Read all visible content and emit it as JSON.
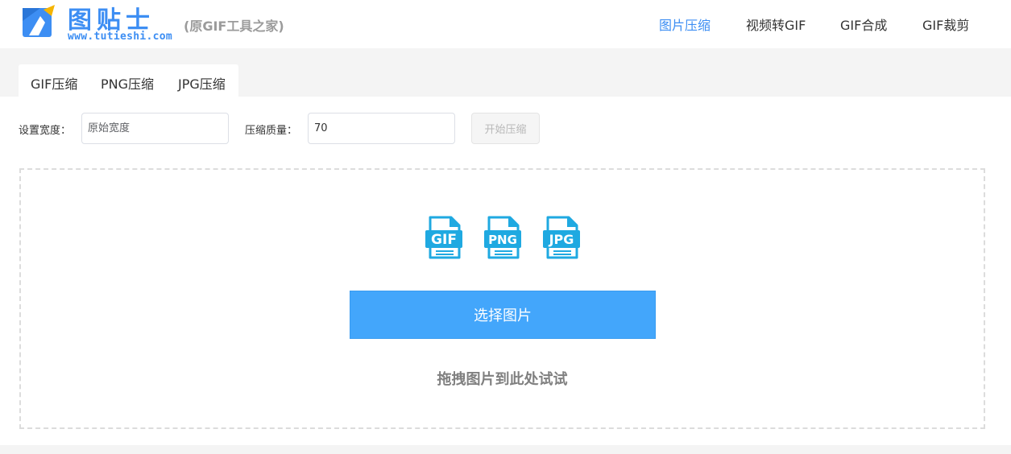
{
  "header": {
    "logo_title": "图贴士",
    "logo_url": "www.tutieshi.com",
    "logo_subtitle": "(原GIF工具之家)",
    "nav": [
      {
        "label": "图片压缩",
        "active": true
      },
      {
        "label": "视频转GIF",
        "active": false
      },
      {
        "label": "GIF合成",
        "active": false
      },
      {
        "label": "GIF裁剪",
        "active": false
      }
    ]
  },
  "tabs": [
    {
      "label": "GIF压缩"
    },
    {
      "label": "PNG压缩"
    },
    {
      "label": "JPG压缩"
    }
  ],
  "form": {
    "width_label": "设置宽度：",
    "width_placeholder": "原始宽度",
    "width_value": "",
    "quality_label": "压缩质量：",
    "quality_value": "70",
    "start_button": "开始压缩"
  },
  "dropzone": {
    "icons": [
      {
        "name": "gif-file-icon",
        "text": "GIF"
      },
      {
        "name": "png-file-icon",
        "text": "PNG"
      },
      {
        "name": "jpg-file-icon",
        "text": "JPG"
      }
    ],
    "select_button": "选择图片",
    "hint": "拖拽图片到此处试试"
  },
  "colors": {
    "brand_blue": "#3d8ef3",
    "button_blue": "#43a6fb",
    "icon_blue": "#1fa9e1"
  }
}
